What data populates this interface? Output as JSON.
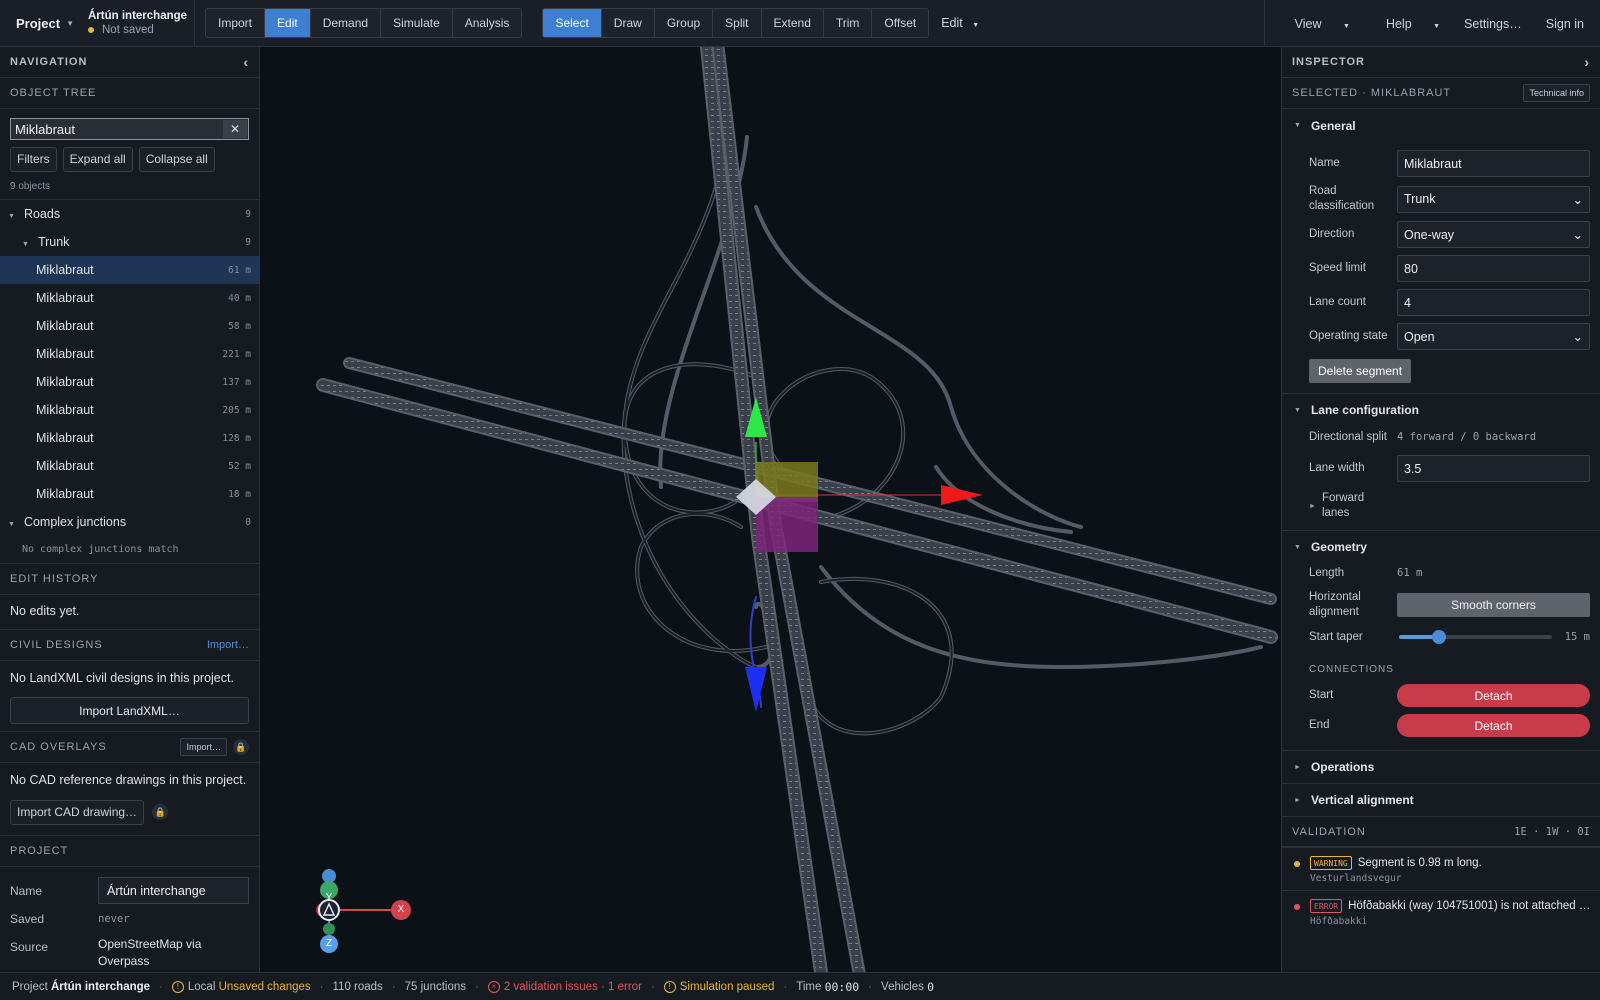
{
  "topbar": {
    "project_label": "Project",
    "project_name": "Ártún interchange",
    "save_state": "Not saved",
    "modes": [
      "Import",
      "Edit",
      "Demand",
      "Simulate",
      "Analysis"
    ],
    "active_mode": "Edit",
    "tools": [
      "Select",
      "Draw",
      "Group",
      "Split",
      "Extend",
      "Trim",
      "Offset"
    ],
    "active_tool": "Select",
    "edit_menu": "Edit",
    "right": {
      "view": "View",
      "help": "Help",
      "settings": "Settings…",
      "sign_in": "Sign in"
    }
  },
  "nav": {
    "title": "NAVIGATION",
    "object_tree": "OBJECT TREE",
    "search_value": "Miklabraut",
    "filters": "Filters",
    "expand_all": "Expand all",
    "collapse_all": "Collapse all",
    "count": "9 objects",
    "roads": {
      "label": "Roads",
      "count": "9"
    },
    "trunk": {
      "label": "Trunk",
      "count": "9"
    },
    "items": [
      {
        "label": "Miklabraut",
        "len": "61 m"
      },
      {
        "label": "Miklabraut",
        "len": "40 m"
      },
      {
        "label": "Miklabraut",
        "len": "58 m"
      },
      {
        "label": "Miklabraut",
        "len": "221 m"
      },
      {
        "label": "Miklabraut",
        "len": "137 m"
      },
      {
        "label": "Miklabraut",
        "len": "205 m"
      },
      {
        "label": "Miklabraut",
        "len": "128 m"
      },
      {
        "label": "Miklabraut",
        "len": "52 m"
      },
      {
        "label": "Miklabraut",
        "len": "18 m"
      }
    ],
    "complex": {
      "label": "Complex junctions",
      "count": "0"
    },
    "complex_empty": "No complex junctions match",
    "edit_history": "EDIT HISTORY",
    "no_edits": "No edits yet.",
    "civil": "CIVIL DESIGNS",
    "civil_import": "Import…",
    "civil_empty": "No LandXML civil designs in this project.",
    "import_landxml": "Import LandXML…",
    "cad": "CAD OVERLAYS",
    "cad_import": "Import…",
    "cad_empty": "No CAD reference drawings in this project.",
    "import_cad": "Import CAD drawing…",
    "project": "PROJECT",
    "p_name_label": "Name",
    "p_name_value": "Ártún interchange",
    "p_saved_label": "Saved",
    "p_saved_value": "never",
    "p_source_label": "Source",
    "p_source_value": "OpenStreetMap via Overpass"
  },
  "gizmo": {
    "y": "Y",
    "x": "X",
    "z": "Z"
  },
  "inspector": {
    "title": "INSPECTOR",
    "selected": "SELECTED · MIKLABRAUT",
    "tech_info": "Technical info",
    "general": "General",
    "name_label": "Name",
    "name_value": "Miklabraut",
    "class_label": "Road classification",
    "class_value": "Trunk",
    "dir_label": "Direction",
    "dir_value": "One-way",
    "speed_label": "Speed limit",
    "speed_value": "80",
    "lanes_label": "Lane count",
    "lanes_value": "4",
    "opstate_label": "Operating state",
    "opstate_value": "Open",
    "delete": "Delete segment",
    "lane_config": "Lane configuration",
    "split_label": "Directional split",
    "split_value": "4 forward / 0 backward",
    "lane_width_label": "Lane width",
    "lane_width_value": "3.5",
    "forward_lanes": "Forward lanes",
    "geometry": "Geometry",
    "length_label": "Length",
    "length_value": "61 m",
    "halign_label": "Horizontal alignment",
    "smooth": "Smooth corners",
    "taper_label": "Start taper",
    "taper_value": "15 m",
    "taper_fraction": 0.27,
    "connections": "CONNECTIONS",
    "start_label": "Start",
    "end_label": "End",
    "detach": "Detach",
    "operations": "Operations",
    "valign": "Vertical alignment",
    "validation": "VALIDATION",
    "validation_counts": "1E · 1W · 0I",
    "v_items": [
      {
        "badge": "WARNING",
        "text": "Segment is 0.98 m long.",
        "sub": "Vesturlandsvegur",
        "color": "#e7b53a"
      },
      {
        "badge": "ERROR",
        "text": "Höfðabakki (way 104751001) is not attached …",
        "sub": "Höfðabakki",
        "color": "#e0565f"
      }
    ]
  },
  "status": {
    "project_label": "Project",
    "project_name": "Ártún interchange",
    "local": "Local",
    "unsaved": "Unsaved changes",
    "roads": "110 roads",
    "junctions": "75 junctions",
    "issues": "2 validation issues · 1 error",
    "sim": "Simulation paused",
    "time_label": "Time",
    "time_value": "00:00",
    "veh_label": "Vehicles",
    "veh_value": "0"
  },
  "colors": {
    "accent": "#3e7fd1",
    "warning": "#e7b53a",
    "error": "#e0565f",
    "detach": "#c83b4a"
  }
}
